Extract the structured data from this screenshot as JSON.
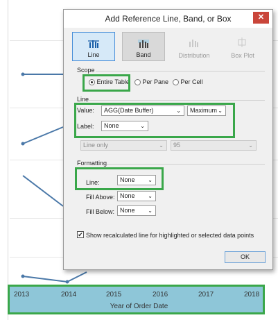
{
  "background_chart": {
    "axis_ticks": [
      "2013",
      "2014",
      "2015",
      "2016",
      "2017",
      "2018"
    ],
    "axis_title": "Year of Order Date",
    "axis_band_color": "#8ec6d8"
  },
  "dialog": {
    "title": "Add Reference Line, Band, or Box",
    "close_icon": "close-icon",
    "type_tabs": [
      {
        "label": "Line",
        "selected": true,
        "enabled": true
      },
      {
        "label": "Band",
        "selected": false,
        "enabled": true
      },
      {
        "label": "Distribution",
        "selected": false,
        "enabled": false
      },
      {
        "label": "Box Plot",
        "selected": false,
        "enabled": false
      }
    ],
    "scope": {
      "heading": "Scope",
      "options": [
        {
          "label": "Entire Table",
          "selected": true
        },
        {
          "label": "Per Pane",
          "selected": false
        },
        {
          "label": "Per Cell",
          "selected": false
        }
      ]
    },
    "line": {
      "heading": "Line",
      "value_label": "Value:",
      "value_field": "AGG(Date Buffer)",
      "aggregation": "Maximum",
      "label_label": "Label:",
      "label_value": "None",
      "disabled_mode": "Line only",
      "disabled_percent": "95"
    },
    "formatting": {
      "heading": "Formatting",
      "line_label": "Line:",
      "line_value": "None",
      "fill_above_label": "Fill Above:",
      "fill_above_value": "None",
      "fill_below_label": "Fill Below:",
      "fill_below_value": "None"
    },
    "recalc_checkbox": {
      "label": "Show recalculated line for highlighted or selected data points",
      "checked": true
    },
    "ok_label": "OK"
  },
  "highlight_color": "#3aa74a"
}
